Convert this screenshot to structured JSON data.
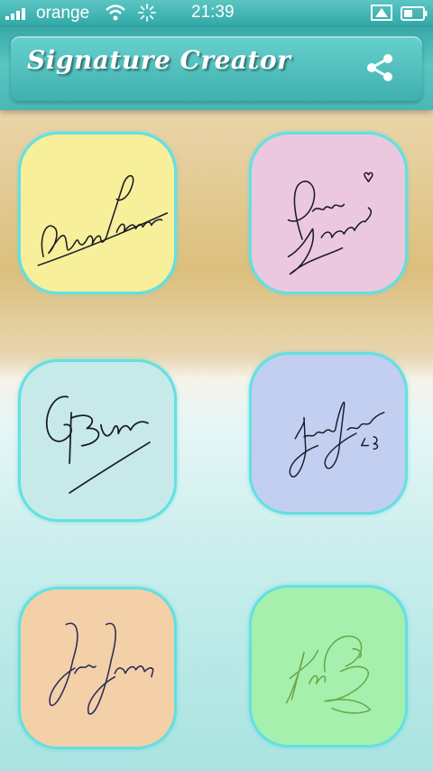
{
  "status_bar": {
    "carrier": "orange",
    "time": "21:39",
    "icons": [
      "signal-icon",
      "wifi-icon",
      "activity-spinner-icon",
      "location-icon",
      "battery-icon"
    ]
  },
  "app_bar": {
    "title": "Signature Creator",
    "share_icon": "share-icon"
  },
  "colors": {
    "accent": "#3fb0ae",
    "tile_border": "#63e0e3"
  },
  "tiles": [
    {
      "id": "arnold-palmer",
      "bg": "#f8ef9a",
      "ink": "#1a1a2a"
    },
    {
      "id": "diego-lacetto",
      "bg": "#ecc8df",
      "ink": "#1a1a2a"
    },
    {
      "id": "gb",
      "bg": "#c7eae8",
      "ink": "#1a1a2a"
    },
    {
      "id": "jimmy-johnson",
      "bg": "#c3cff0",
      "ink": "#1a1a2a"
    },
    {
      "id": "jones",
      "bg": "#f3d0a8",
      "ink": "#2a2a5a"
    },
    {
      "id": "green-autograph",
      "bg": "#a6f0ad",
      "ink": "#6aa84a"
    }
  ]
}
